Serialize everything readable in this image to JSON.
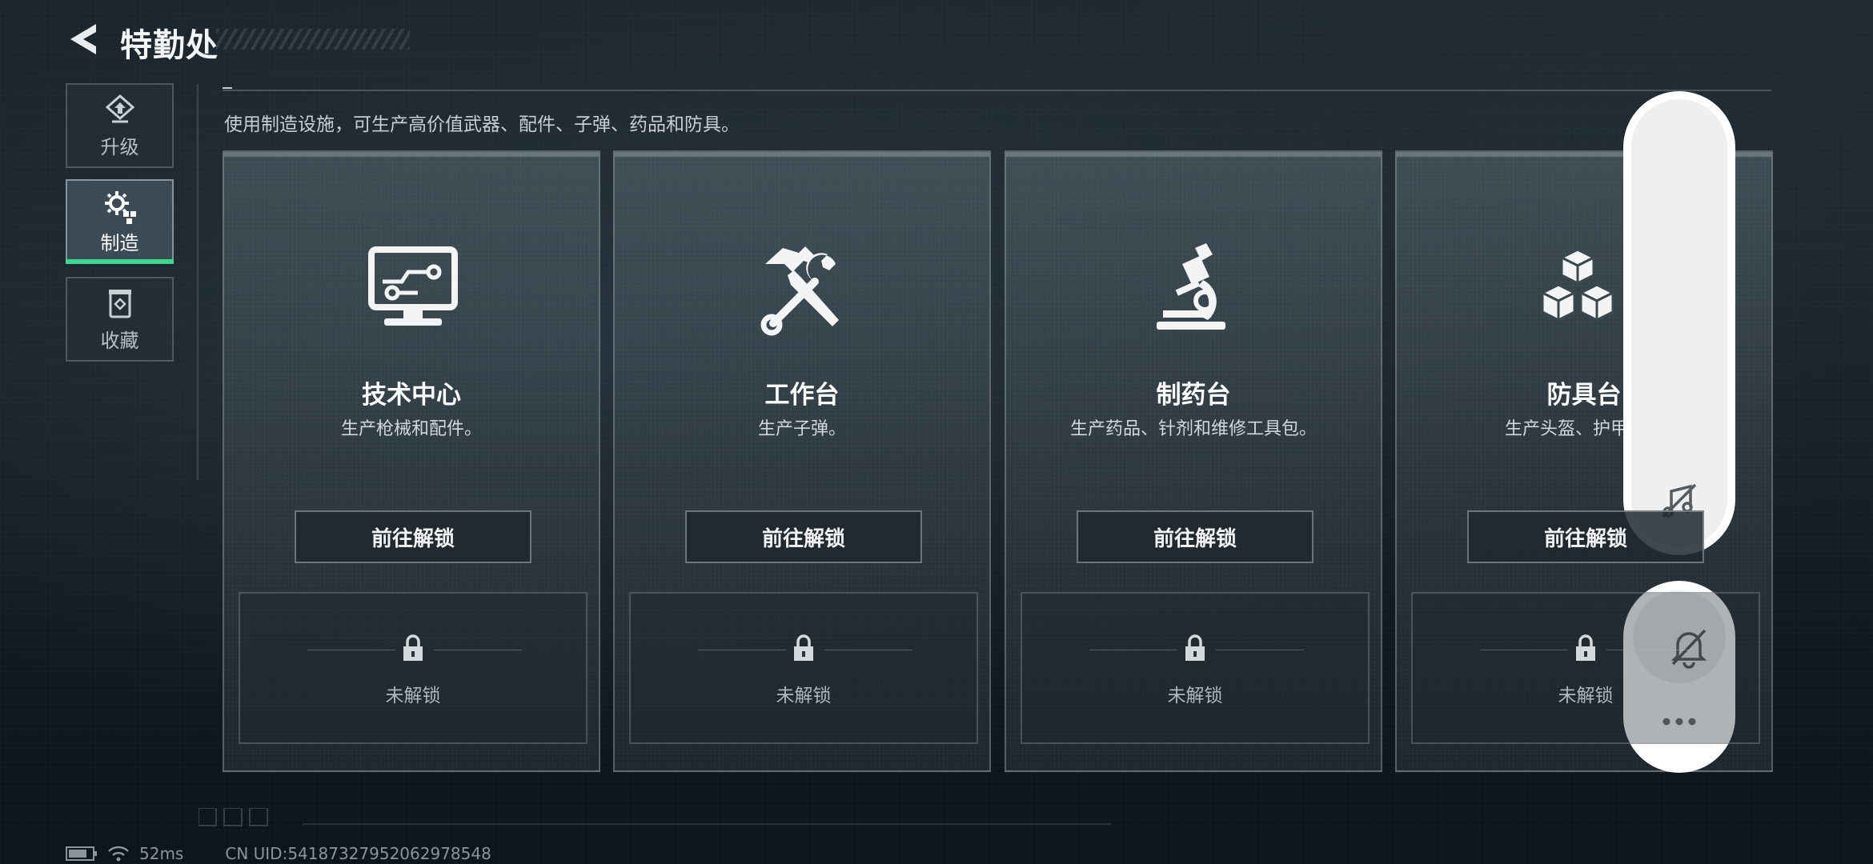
{
  "header": {
    "title": "特勤处"
  },
  "sidebar": {
    "items": [
      {
        "label": "升级",
        "icon": "upgrade-icon",
        "active": false
      },
      {
        "label": "制造",
        "icon": "gear-build-icon",
        "active": true
      },
      {
        "label": "收藏",
        "icon": "collection-icon",
        "active": false
      }
    ]
  },
  "main": {
    "description": "使用制造设施，可生产高价值武器、配件、子弹、药品和防具。",
    "cards": [
      {
        "name": "技术中心",
        "subtitle": "生产枪械和配件。",
        "icon": "computer-monitor-icon",
        "button_label": "前往解锁",
        "status_label": "未解锁"
      },
      {
        "name": "工作台",
        "subtitle": "生产子弹。",
        "icon": "hammer-wrench-icon",
        "button_label": "前往解锁",
        "status_label": "未解锁"
      },
      {
        "name": "制药台",
        "subtitle": "生产药品、针剂和维修工具包。",
        "icon": "microscope-icon",
        "button_label": "前往解锁",
        "status_label": "未解锁"
      },
      {
        "name": "防具台",
        "subtitle": "生产头盔、护甲、胸",
        "icon": "cubes-icon",
        "button_label": "前往解锁",
        "status_label": "未解锁"
      }
    ]
  },
  "status_bar": {
    "ping": "52ms",
    "uid": "CN UID:54187327952062978548"
  },
  "colors": {
    "accent": "#3fd68f",
    "background": "#101820",
    "overlay": "#ffffff"
  }
}
